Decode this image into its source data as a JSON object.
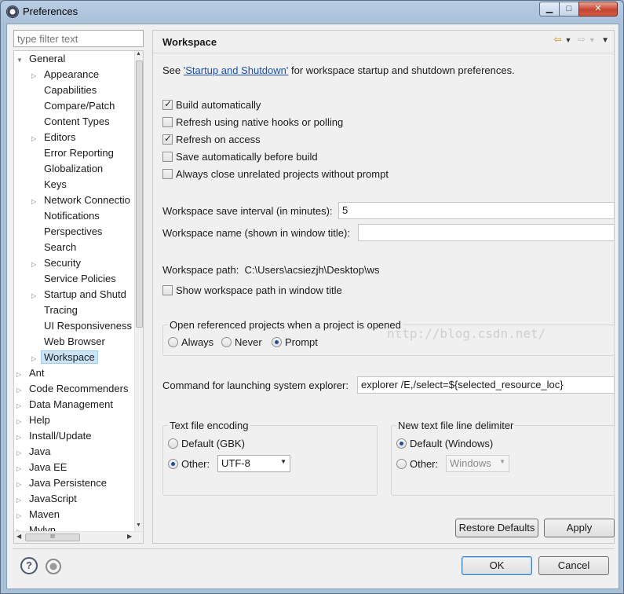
{
  "window": {
    "title": "Preferences",
    "minimize": "▁",
    "maximize": "□",
    "close": "✕"
  },
  "filter": {
    "placeholder": "type filter text"
  },
  "tree": {
    "nodes": [
      {
        "label": "General",
        "level": 0,
        "toggle": "▼"
      },
      {
        "label": "Appearance",
        "level": 1,
        "toggle": "▷"
      },
      {
        "label": "Capabilities",
        "level": 1,
        "toggle": ""
      },
      {
        "label": "Compare/Patch",
        "level": 1,
        "toggle": ""
      },
      {
        "label": "Content Types",
        "level": 1,
        "toggle": ""
      },
      {
        "label": "Editors",
        "level": 1,
        "toggle": "▷"
      },
      {
        "label": "Error Reporting",
        "level": 1,
        "toggle": ""
      },
      {
        "label": "Globalization",
        "level": 1,
        "toggle": ""
      },
      {
        "label": "Keys",
        "level": 1,
        "toggle": ""
      },
      {
        "label": "Network Connectio",
        "level": 1,
        "toggle": "▷"
      },
      {
        "label": "Notifications",
        "level": 1,
        "toggle": ""
      },
      {
        "label": "Perspectives",
        "level": 1,
        "toggle": ""
      },
      {
        "label": "Search",
        "level": 1,
        "toggle": ""
      },
      {
        "label": "Security",
        "level": 1,
        "toggle": "▷"
      },
      {
        "label": "Service Policies",
        "level": 1,
        "toggle": ""
      },
      {
        "label": "Startup and Shutd",
        "level": 1,
        "toggle": "▷"
      },
      {
        "label": "Tracing",
        "level": 1,
        "toggle": ""
      },
      {
        "label": "UI Responsiveness",
        "level": 1,
        "toggle": ""
      },
      {
        "label": "Web Browser",
        "level": 1,
        "toggle": ""
      },
      {
        "label": "Workspace",
        "level": 1,
        "toggle": "▷",
        "selected": true
      },
      {
        "label": "Ant",
        "level": 0,
        "toggle": "▷"
      },
      {
        "label": "Code Recommenders",
        "level": 0,
        "toggle": "▷"
      },
      {
        "label": "Data Management",
        "level": 0,
        "toggle": "▷"
      },
      {
        "label": "Help",
        "level": 0,
        "toggle": "▷"
      },
      {
        "label": "Install/Update",
        "level": 0,
        "toggle": "▷"
      },
      {
        "label": "Java",
        "level": 0,
        "toggle": "▷"
      },
      {
        "label": "Java EE",
        "level": 0,
        "toggle": "▷"
      },
      {
        "label": "Java Persistence",
        "level": 0,
        "toggle": "▷"
      },
      {
        "label": "JavaScript",
        "level": 0,
        "toggle": "▷"
      },
      {
        "label": "Maven",
        "level": 0,
        "toggle": "▷"
      },
      {
        "label": "Mylyn",
        "level": 0,
        "toggle": "▷"
      }
    ],
    "hscroll_grip": "III"
  },
  "page": {
    "title": "Workspace",
    "see_prefix": "See ",
    "see_link": "'Startup and Shutdown'",
    "see_suffix": " for workspace startup and shutdown preferences.",
    "checkboxes": {
      "build_auto": {
        "label": "Build automatically",
        "checked": true
      },
      "refresh_native": {
        "label": "Refresh using native hooks or polling",
        "checked": false
      },
      "refresh_access": {
        "label": "Refresh on access",
        "checked": true
      },
      "save_auto": {
        "label": "Save automatically before build",
        "checked": false
      },
      "close_unrelated": {
        "label": "Always close unrelated projects without prompt",
        "checked": false
      }
    },
    "save_interval": {
      "label": "Workspace save interval (in minutes):",
      "value": "5"
    },
    "ws_name": {
      "label": "Workspace name (shown in window title):",
      "value": ""
    },
    "ws_path": {
      "label": "Workspace path:",
      "value": "C:\\Users\\acsiezjh\\Desktop\\ws"
    },
    "show_path": {
      "label": "Show workspace path in window title",
      "checked": false
    },
    "open_ref": {
      "label": "Open referenced projects when a project is opened",
      "always": "Always",
      "never": "Never",
      "prompt": "Prompt",
      "selected": "Prompt"
    },
    "explorer": {
      "label": "Command for launching system explorer:",
      "value": "explorer /E,/select=${selected_resource_loc}"
    },
    "encoding": {
      "label": "Text file encoding",
      "default": "Default (GBK)",
      "other": "Other:",
      "other_value": "UTF-8",
      "selected": "Other"
    },
    "delimiter": {
      "label": "New text file line delimiter",
      "default": "Default (Windows)",
      "other": "Other:",
      "other_value": "Windows",
      "selected": "Default"
    },
    "watermark": "http://blog.csdn.net/",
    "restore_defaults": "Restore Defaults",
    "apply": "Apply"
  },
  "footer": {
    "ok": "OK",
    "cancel": "Cancel"
  }
}
